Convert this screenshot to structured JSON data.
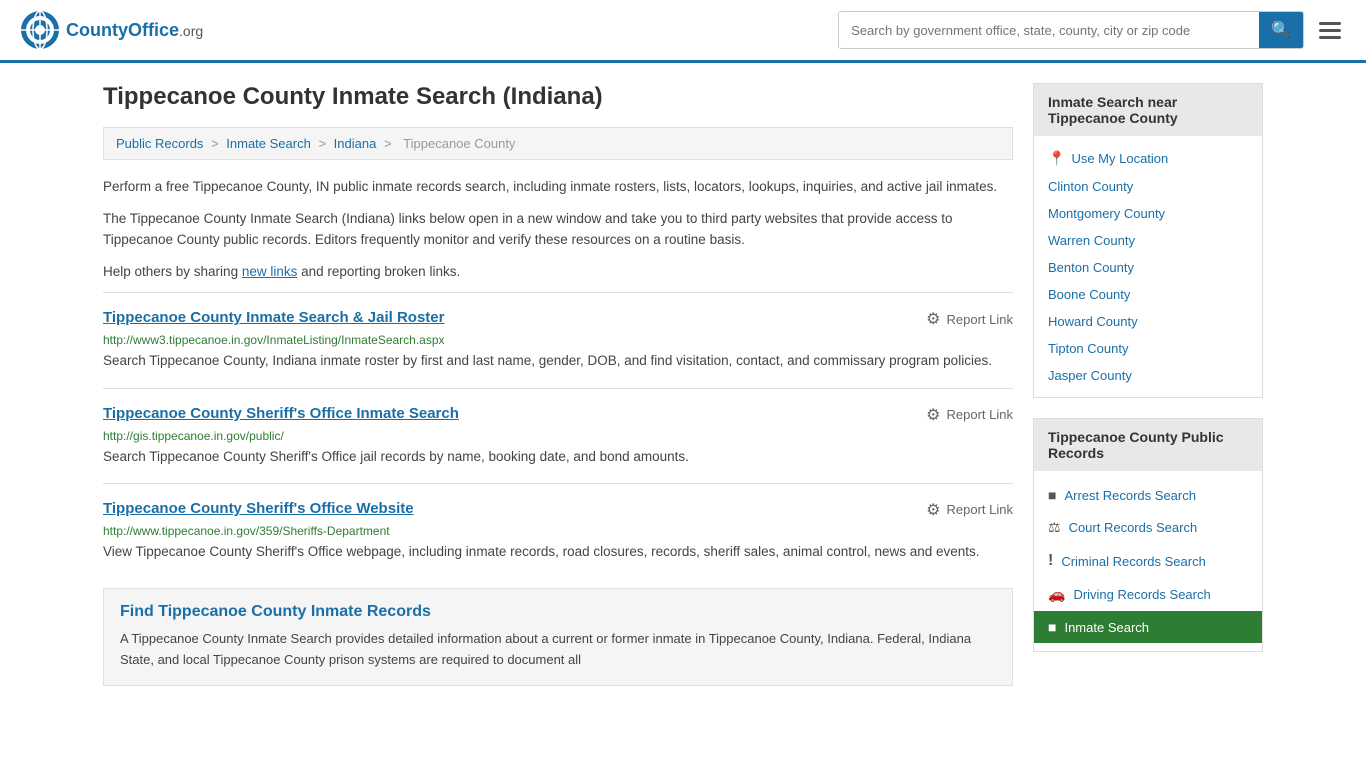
{
  "header": {
    "logo_text": "CountyOffice",
    "logo_suffix": ".org",
    "search_placeholder": "Search by government office, state, county, city or zip code",
    "search_value": ""
  },
  "page": {
    "title": "Tippecanoe County Inmate Search (Indiana)",
    "breadcrumbs": [
      {
        "label": "Public Records",
        "href": "#"
      },
      {
        "label": "Inmate Search",
        "href": "#"
      },
      {
        "label": "Indiana",
        "href": "#"
      },
      {
        "label": "Tippecanoe County",
        "href": "#"
      }
    ],
    "intro1": "Perform a free Tippecanoe County, IN public inmate records search, including inmate rosters, lists, locators, lookups, inquiries, and active jail inmates.",
    "intro2": "The Tippecanoe County Inmate Search (Indiana) links below open in a new window and take you to third party websites that provide access to Tippecanoe County public records. Editors frequently monitor and verify these resources on a routine basis.",
    "intro3_prefix": "Help others by sharing ",
    "intro3_link": "new links",
    "intro3_suffix": " and reporting broken links.",
    "results": [
      {
        "title": "Tippecanoe County Inmate Search & Jail Roster",
        "url": "http://www3.tippecanoe.in.gov/InmateListing/InmateSearch.aspx",
        "desc": "Search Tippecanoe County, Indiana inmate roster by first and last name, gender, DOB, and find visitation, contact, and commissary program policies.",
        "report_label": "Report Link"
      },
      {
        "title": "Tippecanoe County Sheriff's Office Inmate Search",
        "url": "http://gis.tippecanoe.in.gov/public/",
        "desc": "Search Tippecanoe County Sheriff's Office jail records by name, booking date, and bond amounts.",
        "report_label": "Report Link"
      },
      {
        "title": "Tippecanoe County Sheriff's Office Website",
        "url": "http://www.tippecanoe.in.gov/359/Sheriffs-Department",
        "desc": "View Tippecanoe County Sheriff's Office webpage, including inmate records, road closures, records, sheriff sales, animal control, news and events.",
        "report_label": "Report Link"
      }
    ],
    "find_records": {
      "title": "Find Tippecanoe County Inmate Records",
      "text": "A Tippecanoe County Inmate Search provides detailed information about a current or former inmate in Tippecanoe County, Indiana. Federal, Indiana State, and local Tippecanoe County prison systems are required to document all"
    }
  },
  "sidebar": {
    "nearby_title": "Inmate Search near Tippecanoe County",
    "use_location": "Use My Location",
    "nearby_counties": [
      "Clinton County",
      "Montgomery County",
      "Warren County",
      "Benton County",
      "Boone County",
      "Howard County",
      "Tipton County",
      "Jasper County"
    ],
    "public_records_title": "Tippecanoe County Public Records",
    "public_records": [
      {
        "label": "Arrest Records Search",
        "icon": "■"
      },
      {
        "label": "Court Records Search",
        "icon": "⚖"
      },
      {
        "label": "Criminal Records Search",
        "icon": "!"
      },
      {
        "label": "Driving Records Search",
        "icon": "🚗"
      },
      {
        "label": "Inmate Search",
        "icon": "■",
        "highlight": true
      }
    ]
  }
}
